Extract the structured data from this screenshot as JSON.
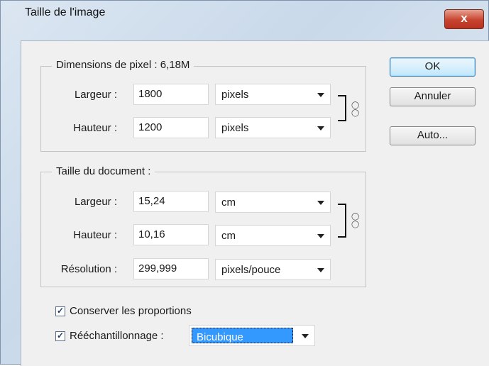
{
  "window": {
    "title": "Taille de l'image",
    "close_label": "x"
  },
  "pixel_dims": {
    "legend": "Dimensions de pixel : 6,18M",
    "width_label": "Largeur :",
    "width_value": "1800",
    "width_unit": "pixels",
    "height_label": "Hauteur :",
    "height_value": "1200",
    "height_unit": "pixels"
  },
  "doc_size": {
    "legend": "Taille du document :",
    "width_label": "Largeur :",
    "width_value": "15,24",
    "width_unit": "cm",
    "height_label": "Hauteur :",
    "height_value": "10,16",
    "height_unit": "cm",
    "res_label": "Résolution :",
    "res_value": "299,999",
    "res_unit": "pixels/pouce"
  },
  "buttons": {
    "ok": "OK",
    "cancel": "Annuler",
    "auto": "Auto..."
  },
  "options": {
    "constrain_label": "Conserver les proportions",
    "constrain_checked": true,
    "resample_label": "Rééchantillonnage :",
    "resample_checked": true,
    "resample_value": "Bicubique"
  },
  "colors": {
    "accent": "#3399ff",
    "close": "#c7432f"
  }
}
